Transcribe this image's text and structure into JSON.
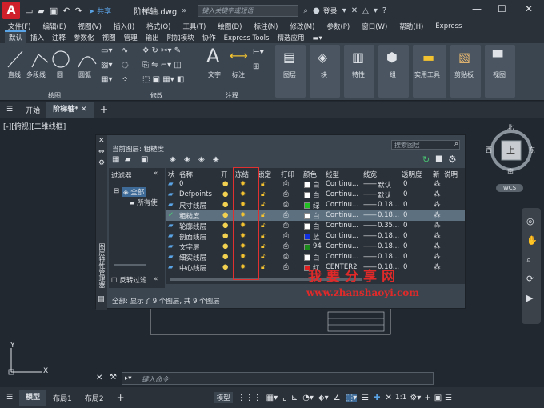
{
  "titlebar": {
    "logo": "A",
    "share": "共享",
    "doc_title": "阶梯轴.dwg",
    "search_placeholder": "键入关键字或短语",
    "login": "登录"
  },
  "menu": [
    "文件(F)",
    "编辑(E)",
    "视图(V)",
    "插入(I)",
    "格式(O)",
    "工具(T)",
    "绘图(D)",
    "标注(N)",
    "修改(M)",
    "参数(P)",
    "窗口(W)",
    "帮助(H)",
    "Express"
  ],
  "ribbon_tabs": [
    "默认",
    "插入",
    "注释",
    "参数化",
    "视图",
    "管理",
    "输出",
    "附加模块",
    "协作",
    "Express Tools",
    "精选应用"
  ],
  "ribbon": {
    "draw_buttons": [
      "直线",
      "多段线",
      "圆",
      "圆弧"
    ],
    "groups": [
      "绘图",
      "修改",
      "注释"
    ],
    "annot_buttons": [
      "文字",
      "标注"
    ],
    "big_buttons": [
      "图层",
      "块",
      "特性",
      "组",
      "实用工具",
      "剪贴板",
      "视图"
    ]
  },
  "doc_tabs": [
    "开始",
    "阶梯轴*"
  ],
  "view_label": "[-][俯视][二维线框]",
  "palette": {
    "current_layer": "当前图层: 粗糙度",
    "search_placeholder": "搜索图层",
    "filter_header": "过滤器",
    "filter_tree": [
      "全部",
      "所有使"
    ],
    "invert_filter": "反转过滤",
    "side_title": "图层特性管理器",
    "columns": [
      "状",
      "名称",
      "开",
      "冻结",
      "锁定",
      "打印",
      "颜色",
      "线型",
      "线宽",
      "透明度",
      "新",
      "说明"
    ],
    "layers": [
      {
        "name": "0",
        "color_name": "白",
        "color": "#ffffff",
        "linetype": "Continu...",
        "lineweight": "默认",
        "transparency": "0"
      },
      {
        "name": "Defpoints",
        "color_name": "白",
        "color": "#ffffff",
        "linetype": "Continu...",
        "lineweight": "默认",
        "transparency": "0"
      },
      {
        "name": "尺寸线层",
        "color_name": "绿",
        "color": "#22c022",
        "linetype": "Continu...",
        "lineweight": "0.18...",
        "transparency": "0"
      },
      {
        "name": "粗糙度",
        "color_name": "白",
        "color": "#ffffff",
        "linetype": "Continu...",
        "lineweight": "0.18...",
        "transparency": "0",
        "current": true
      },
      {
        "name": "轮廓线层",
        "color_name": "白",
        "color": "#ffffff",
        "linetype": "Continu...",
        "lineweight": "0.35...",
        "transparency": "0"
      },
      {
        "name": "剖面线层",
        "color_name": "蓝",
        "color": "#1030e0",
        "linetype": "Continu...",
        "lineweight": "0.18...",
        "transparency": "0"
      },
      {
        "name": "文字层",
        "color_name": "94",
        "color": "#1a8a1a",
        "linetype": "Continu...",
        "lineweight": "0.18...",
        "transparency": "0"
      },
      {
        "name": "细实线层",
        "color_name": "白",
        "color": "#ffffff",
        "linetype": "Continu...",
        "lineweight": "0.18...",
        "transparency": "0"
      },
      {
        "name": "中心线层",
        "color_name": "红",
        "color": "#e02020",
        "linetype": "CENTER2",
        "lineweight": "0.18...",
        "transparency": "0"
      }
    ],
    "status": "全部: 显示了 9 个图层, 共 9 个图层"
  },
  "watermark": {
    "line1": "我要分享网",
    "line2": "www.zhanshaoyi.com"
  },
  "viewcube": {
    "north": "北",
    "south": "南",
    "east": "东",
    "west": "西",
    "top": "上",
    "wcs": "WCS"
  },
  "ucs": {
    "y": "Y",
    "x": "X"
  },
  "command_placeholder": "键入命令",
  "status_tabs": [
    "模型",
    "布局1",
    "布局2"
  ],
  "status_model": "模型",
  "status_scale": "1:1"
}
